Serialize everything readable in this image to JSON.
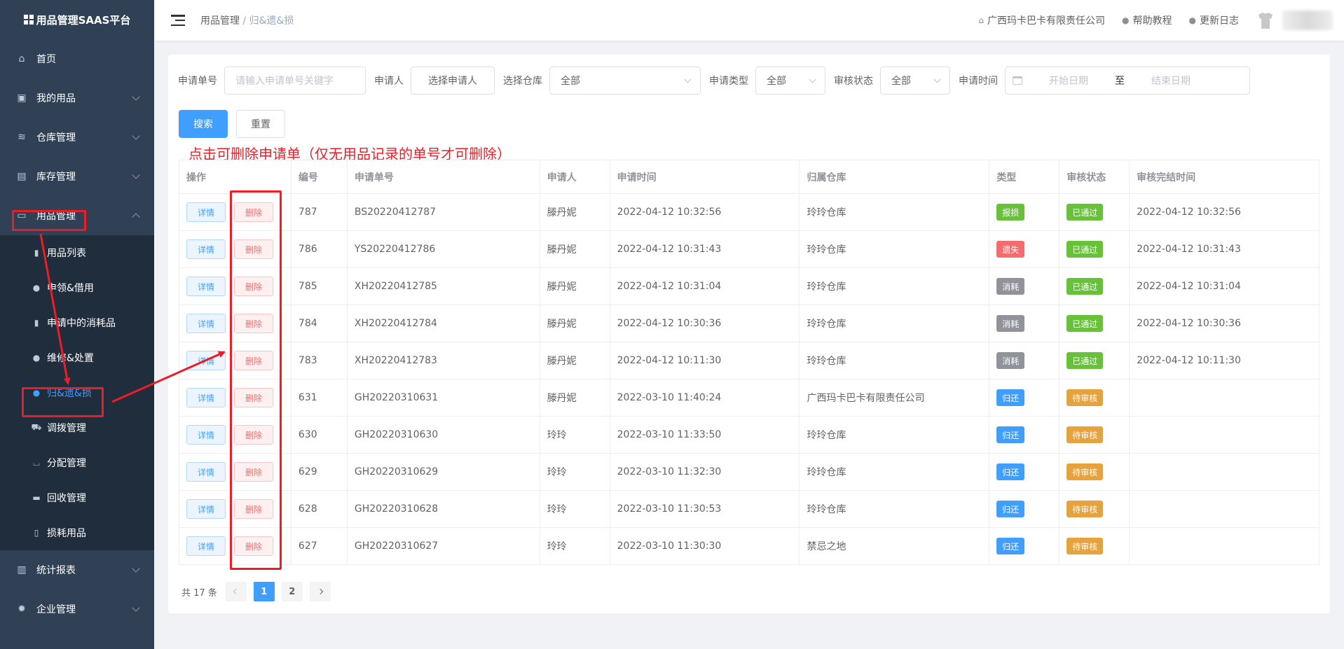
{
  "app": {
    "title": "用品管理SAAS平台"
  },
  "sidebar": {
    "items": [
      {
        "label": "首页",
        "icon": "home-icon"
      },
      {
        "label": "我的用品",
        "icon": "bag-icon"
      },
      {
        "label": "仓库管理",
        "icon": "database-icon"
      },
      {
        "label": "库存管理",
        "icon": "box-icon"
      },
      {
        "label": "用品管理",
        "icon": "inbox-icon"
      }
    ],
    "sub_items": [
      {
        "label": "用品列表",
        "icon": "clipboard-icon"
      },
      {
        "label": "申领&借用",
        "icon": "user-icon"
      },
      {
        "label": "申请中的消耗品",
        "icon": "clipboard-icon"
      },
      {
        "label": "维修&处置",
        "icon": "user-icon"
      },
      {
        "label": "归&遗&损",
        "icon": "user-icon"
      },
      {
        "label": "调拨管理",
        "icon": "truck-icon"
      },
      {
        "label": "分配管理",
        "icon": "cart-icon"
      },
      {
        "label": "回收管理",
        "icon": "archive-icon"
      },
      {
        "label": "损耗用品",
        "icon": "trash-icon"
      }
    ],
    "bottom_items": [
      {
        "label": "统计报表",
        "icon": "bar-chart-icon"
      },
      {
        "label": "企业管理",
        "icon": "gear-icon"
      }
    ]
  },
  "header": {
    "breadcrumb_first": "用品管理",
    "breadcrumb_sep": " / ",
    "breadcrumb_current": "归&遗&损",
    "company": "广西玛卡巴卡有限责任公司",
    "help": "帮助教程",
    "changelog": "更新日志"
  },
  "filters": {
    "order_label": "申请单号",
    "order_placeholder": "请输入申请单号关键字",
    "applicant_label": "申请人",
    "applicant_button": "选择申请人",
    "warehouse_label": "选择仓库",
    "warehouse_value": "全部",
    "type_label": "申请类型",
    "type_value": "全部",
    "status_label": "审核状态",
    "status_value": "全部",
    "time_label": "申请时间",
    "start_placeholder": "开始日期",
    "range_sep": "至",
    "end_placeholder": "结束日期"
  },
  "buttons": {
    "search": "搜索",
    "reset": "重置"
  },
  "annotation": "点击可删除申请单（仅无用品记录的单号才可删除）",
  "table": {
    "columns": [
      "操作",
      "编号",
      "申请单号",
      "申请人",
      "申请时间",
      "归属仓库",
      "类型",
      "审核状态",
      "审核完结时间"
    ],
    "detail_label": "详情",
    "delete_label": "删除",
    "rows": [
      {
        "id": "787",
        "order": "BS20220412787",
        "applicant": "滕丹妮",
        "time": "2022-04-12 10:32:56",
        "warehouse": "玲玲仓库",
        "type": "报损",
        "type_color": "#67c23a",
        "status": "已通过",
        "status_color": "#67c23a",
        "done": "2022-04-12 10:32:56"
      },
      {
        "id": "786",
        "order": "YS20220412786",
        "applicant": "滕丹妮",
        "time": "2022-04-12 10:31:43",
        "warehouse": "玲玲仓库",
        "type": "遗失",
        "type_color": "#f56c6c",
        "status": "已通过",
        "status_color": "#67c23a",
        "done": "2022-04-12 10:31:43"
      },
      {
        "id": "785",
        "order": "XH20220412785",
        "applicant": "滕丹妮",
        "time": "2022-04-12 10:31:04",
        "warehouse": "玲玲仓库",
        "type": "消耗",
        "type_color": "#909399",
        "status": "已通过",
        "status_color": "#67c23a",
        "done": "2022-04-12 10:31:04"
      },
      {
        "id": "784",
        "order": "XH20220412784",
        "applicant": "滕丹妮",
        "time": "2022-04-12 10:30:36",
        "warehouse": "玲玲仓库",
        "type": "消耗",
        "type_color": "#909399",
        "status": "已通过",
        "status_color": "#67c23a",
        "done": "2022-04-12 10:30:36"
      },
      {
        "id": "783",
        "order": "XH20220412783",
        "applicant": "滕丹妮",
        "time": "2022-04-12 10:11:30",
        "warehouse": "玲玲仓库",
        "type": "消耗",
        "type_color": "#909399",
        "status": "已通过",
        "status_color": "#67c23a",
        "done": "2022-04-12 10:11:30"
      },
      {
        "id": "631",
        "order": "GH20220310631",
        "applicant": "滕丹妮",
        "time": "2022-03-10 11:40:24",
        "warehouse": "广西玛卡巴卡有限责任公司",
        "type": "归还",
        "type_color": "#409eff",
        "status": "待审核",
        "status_color": "#e6a23c",
        "done": ""
      },
      {
        "id": "630",
        "order": "GH20220310630",
        "applicant": "玲玲",
        "time": "2022-03-10 11:33:50",
        "warehouse": "玲玲仓库",
        "type": "归还",
        "type_color": "#409eff",
        "status": "待审核",
        "status_color": "#e6a23c",
        "done": ""
      },
      {
        "id": "629",
        "order": "GH20220310629",
        "applicant": "玲玲",
        "time": "2022-03-10 11:32:30",
        "warehouse": "玲玲仓库",
        "type": "归还",
        "type_color": "#409eff",
        "status": "待审核",
        "status_color": "#e6a23c",
        "done": ""
      },
      {
        "id": "628",
        "order": "GH20220310628",
        "applicant": "玲玲",
        "time": "2022-03-10 11:30:53",
        "warehouse": "玲玲仓库",
        "type": "归还",
        "type_color": "#409eff",
        "status": "待审核",
        "status_color": "#e6a23c",
        "done": ""
      },
      {
        "id": "627",
        "order": "GH20220310627",
        "applicant": "玲玲",
        "time": "2022-03-10 11:30:30",
        "warehouse": "禁忌之地",
        "type": "归还",
        "type_color": "#409eff",
        "status": "待审核",
        "status_color": "#e6a23c",
        "done": ""
      }
    ]
  },
  "pagination": {
    "total": "共 17 条",
    "pages": [
      "1",
      "2"
    ],
    "current": "1"
  },
  "colors": {
    "primary": "#409eff",
    "sidebar": "#304156",
    "annotation": "#ee1c25"
  }
}
